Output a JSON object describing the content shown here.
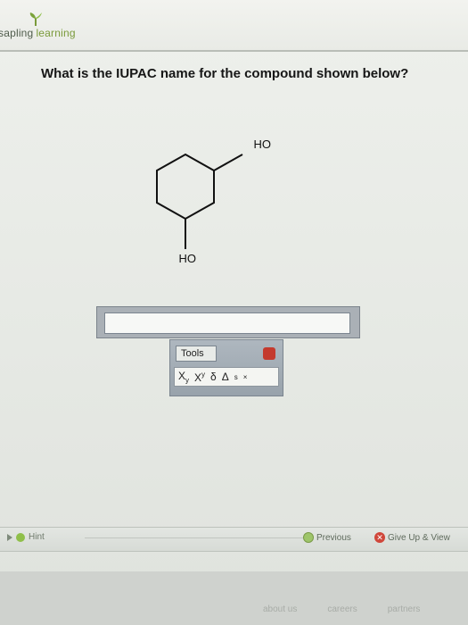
{
  "brand": {
    "part1": "sapling",
    "part2": "learning"
  },
  "question": {
    "text": "What is the IUPAC name for the compound shown below?"
  },
  "molecule": {
    "oh_top": "OH",
    "oh_bottom": "OH"
  },
  "answer": {
    "value": "",
    "placeholder": ""
  },
  "tools": {
    "tab_label": "Tools",
    "buttons": [
      "X",
      "y",
      "X",
      "y",
      "δ",
      "Δ",
      "s",
      "×"
    ]
  },
  "bottom": {
    "hint_label": "Hint",
    "previous_label": "Previous",
    "give_up_label": "Give Up & View"
  },
  "footer": {
    "links": [
      "about us",
      "careers",
      "partners"
    ]
  }
}
